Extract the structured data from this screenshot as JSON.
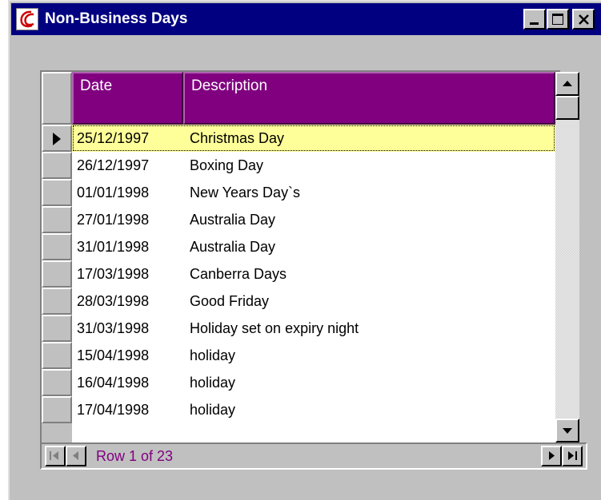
{
  "window": {
    "title": "Non-Business Days",
    "icon": "app-logo-icon"
  },
  "grid": {
    "columns": [
      "Date",
      "Description"
    ],
    "rows": [
      {
        "date": "25/12/1997",
        "description": "Christmas Day",
        "selected": true
      },
      {
        "date": "26/12/1997",
        "description": "Boxing Day"
      },
      {
        "date": "01/01/1998",
        "description": "New Years Day`s"
      },
      {
        "date": "27/01/1998",
        "description": "Australia Day"
      },
      {
        "date": "31/01/1998",
        "description": "Australia Day"
      },
      {
        "date": "17/03/1998",
        "description": "Canberra Days"
      },
      {
        "date": "28/03/1998",
        "description": "Good Friday"
      },
      {
        "date": "31/03/1998",
        "description": "Holiday set on expiry night"
      },
      {
        "date": "15/04/1998",
        "description": "holiday"
      },
      {
        "date": "16/04/1998",
        "description": "holiday"
      },
      {
        "date": "17/04/1998",
        "description": "holiday"
      }
    ]
  },
  "navigator": {
    "status": "Row 1 of 23"
  },
  "colors": {
    "titlebar": "#000080",
    "header": "#800080",
    "selected_row": "#ffff99",
    "status_text": "#800080"
  }
}
